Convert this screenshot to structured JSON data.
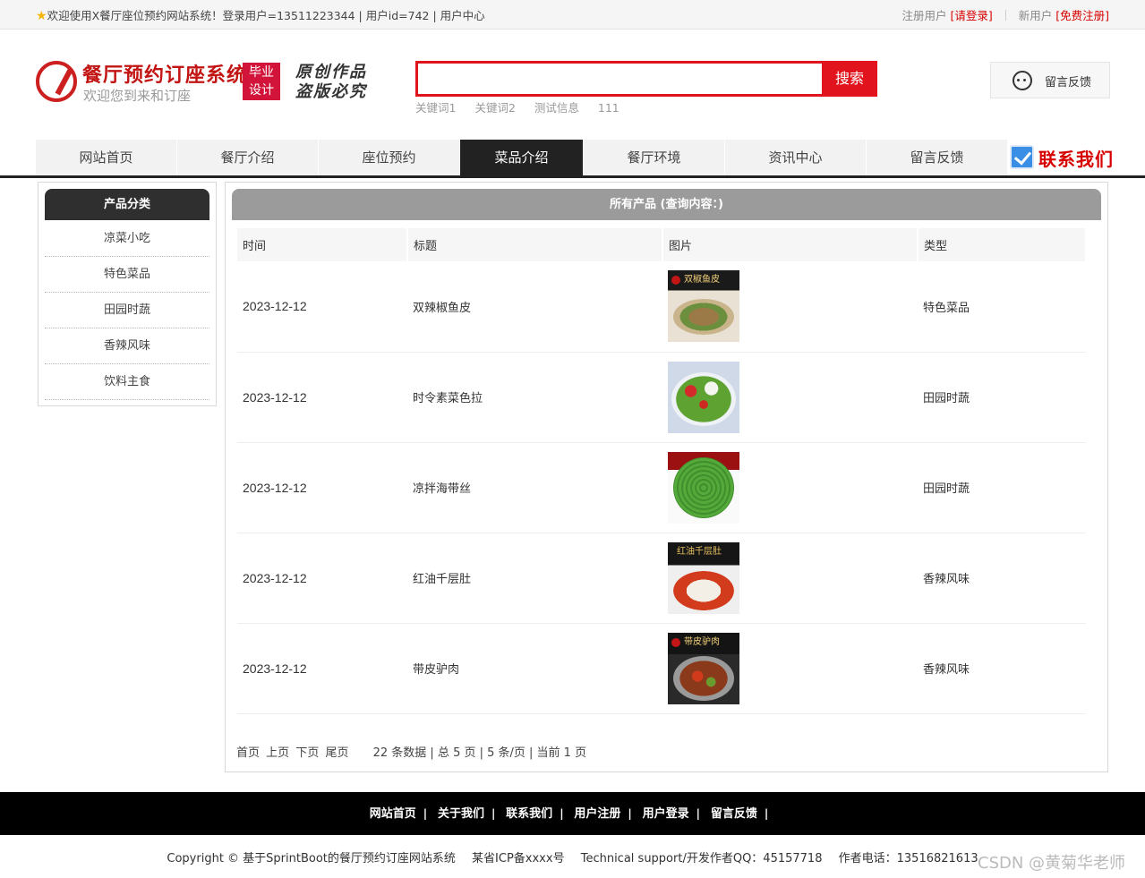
{
  "topbar": {
    "welcome": "欢迎使用X餐厅座位预约网站系统！登录用户=13511223344 | 用户id=742 | 用户中心",
    "registered_label": "注册用户",
    "login_link": "[请登录]",
    "new_user_label": "新用户",
    "register_link": "[免费注册]"
  },
  "header": {
    "title": "餐厅预约订座系统",
    "subtitle": "欢迎您到来和订座",
    "badge_line1": "毕业",
    "badge_line2": "设计",
    "slogan_line1": "原创作品",
    "slogan_line2": "盗版必究",
    "search_placeholder": "",
    "search_button": "搜索",
    "keywords": [
      "关键词1",
      "关键词2",
      "测试信息",
      "111"
    ],
    "feedback": "留言反馈"
  },
  "nav": {
    "items": [
      "网站首页",
      "餐厅介绍",
      "座位预约",
      "菜品介绍",
      "餐厅环境",
      "资讯中心",
      "留言反馈"
    ],
    "active": "菜品介绍",
    "contact": "联系我们"
  },
  "sidebar": {
    "title": "产品分类",
    "items": [
      "凉菜小吃",
      "特色菜品",
      "田园时蔬",
      "香辣风味",
      "饮料主食"
    ]
  },
  "main": {
    "title": "所有产品 (查询内容：)",
    "columns": [
      "时间",
      "标题",
      "图片",
      "类型"
    ],
    "rows": [
      {
        "date": "2023-12-12",
        "title": "双辣椒鱼皮",
        "image_caption": "双椒鱼皮",
        "type": "特色菜品"
      },
      {
        "date": "2023-12-12",
        "title": "时令素菜色拉",
        "image_caption": "",
        "type": "田园时蔬"
      },
      {
        "date": "2023-12-12",
        "title": "凉拌海带丝",
        "image_caption": "",
        "type": "田园时蔬"
      },
      {
        "date": "2023-12-12",
        "title": "红油千层肚",
        "image_caption": "红油千层肚",
        "type": "香辣风味"
      },
      {
        "date": "2023-12-12",
        "title": "带皮驴肉",
        "image_caption": "带皮驴肉",
        "type": "香辣风味"
      }
    ],
    "pager": {
      "first": "首页",
      "prev": "上页",
      "next": "下页",
      "last": "尾页",
      "info": "22 条数据 | 总 5 页 | 5 条/页 | 当前 1 页"
    }
  },
  "footer": {
    "links": [
      "网站首页",
      "关于我们",
      "联系我们",
      "用户注册",
      "用户登录",
      "留言反馈"
    ],
    "copyright": "Copyright © 基于SprintBoot的餐厅预约订座网站系统",
    "icp": "某省ICP备xxxx号",
    "support": "Technical support/开发作者QQ：45157718",
    "phone": "作者电话：13516821613"
  },
  "watermark": "CSDN @黄菊华老师",
  "colors": {
    "accent": "#e1141e",
    "nav_active": "#222222",
    "footer_bg": "#000000"
  }
}
